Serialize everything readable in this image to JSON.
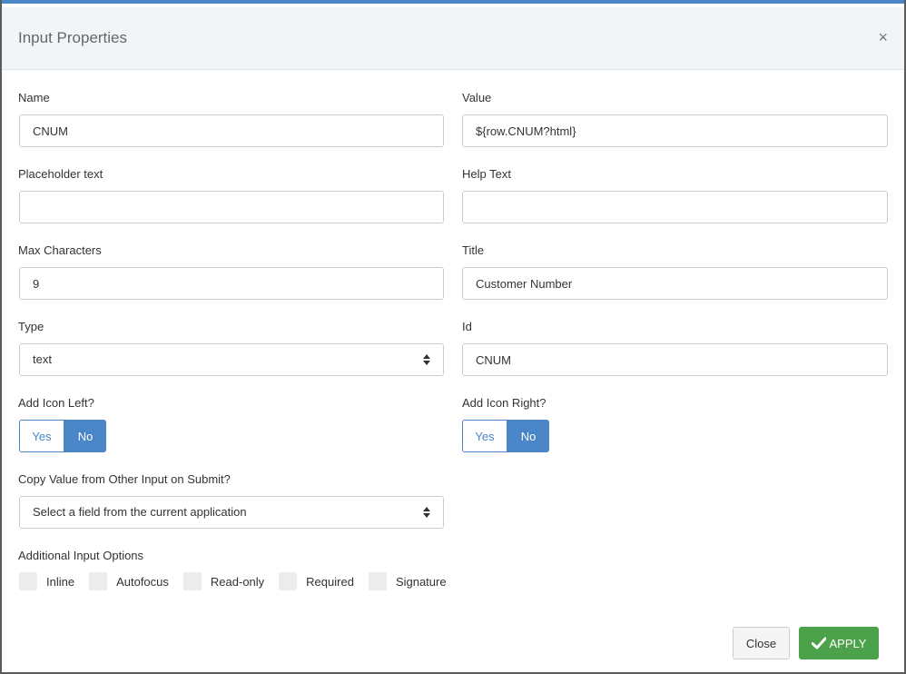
{
  "dialog": {
    "title": "Input Properties",
    "close_glyph": "×"
  },
  "fields": {
    "name": {
      "label": "Name",
      "value": "CNUM"
    },
    "value": {
      "label": "Value",
      "value": "${row.CNUM?html}"
    },
    "placeholder": {
      "label": "Placeholder text",
      "value": ""
    },
    "help_text": {
      "label": "Help Text",
      "value": ""
    },
    "max_chars": {
      "label": "Max Characters",
      "value": "9"
    },
    "title": {
      "label": "Title",
      "value": "Customer Number"
    },
    "type": {
      "label": "Type",
      "value": "text"
    },
    "id": {
      "label": "Id",
      "value": "CNUM"
    },
    "icon_left": {
      "label": "Add Icon Left?",
      "yes": "Yes",
      "no": "No",
      "selected": "No"
    },
    "icon_right": {
      "label": "Add Icon Right?",
      "yes": "Yes",
      "no": "No",
      "selected": "No"
    },
    "copy_value": {
      "label": "Copy Value from Other Input on Submit?",
      "value": "Select a field from the current application"
    }
  },
  "options": {
    "label": "Additional Input Options",
    "items": [
      "Inline",
      "Autofocus",
      "Read-only",
      "Required",
      "Signature"
    ]
  },
  "buttons": {
    "close": "Close",
    "apply": "APPLY"
  },
  "colors": {
    "accent": "#4a86c8",
    "apply": "#4ba24b"
  }
}
